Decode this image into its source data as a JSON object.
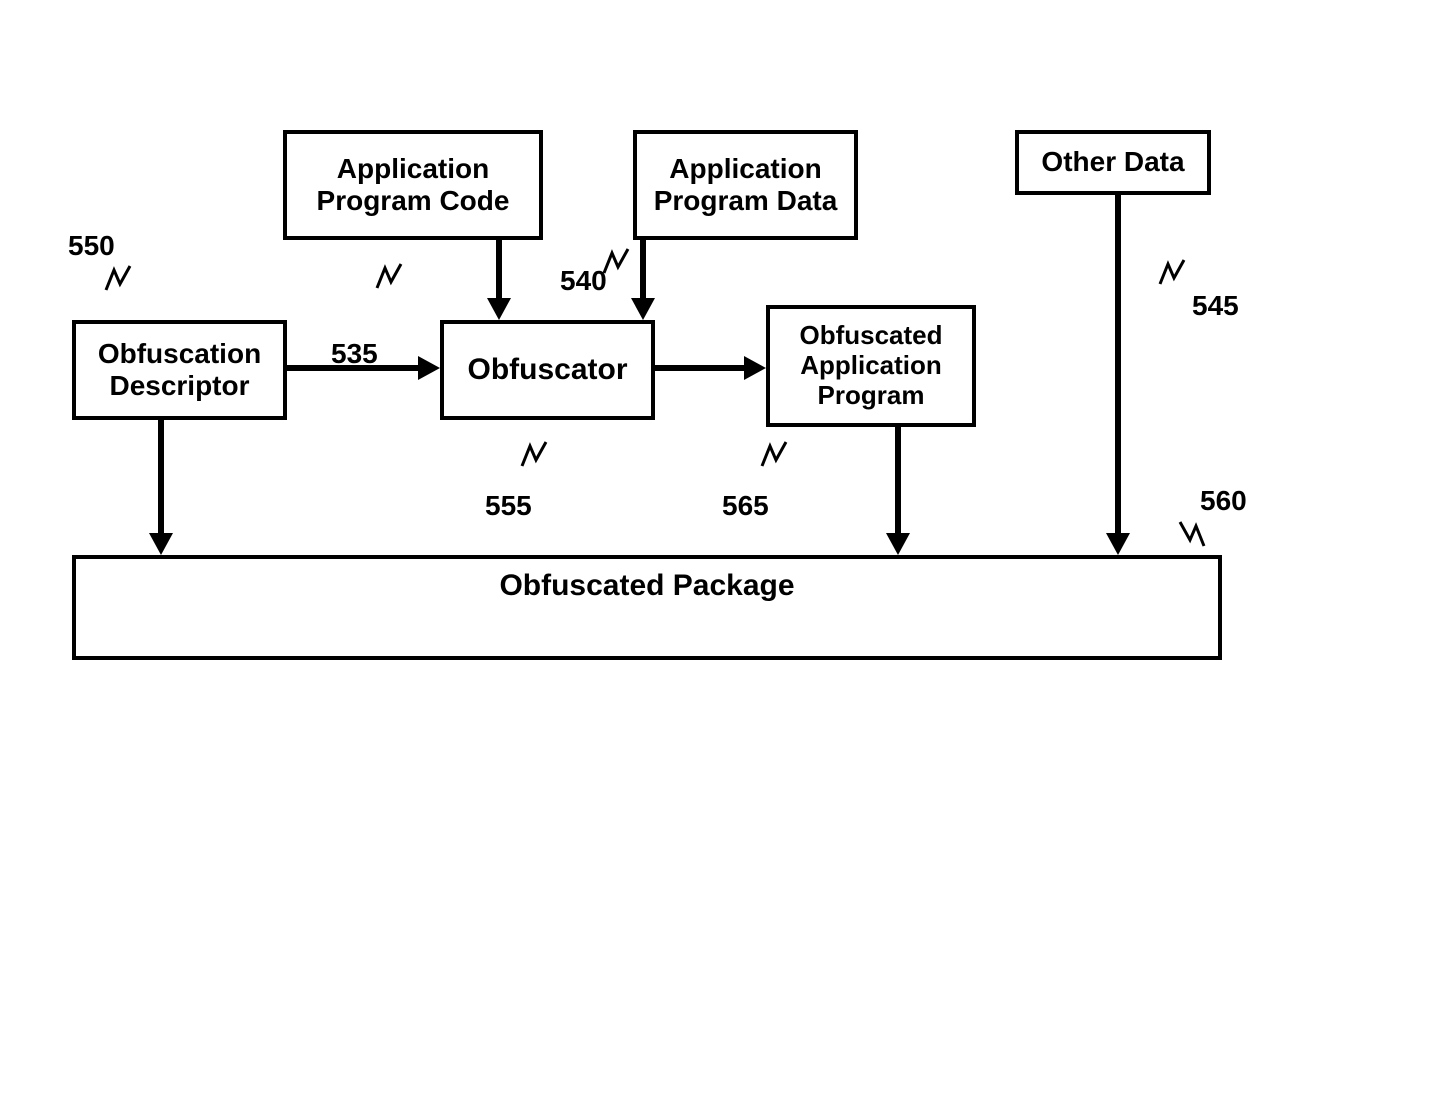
{
  "boxes": {
    "app_code": "Application\nProgram Code",
    "app_data": "Application\nProgram Data",
    "other_data": "Other Data",
    "obf_desc": "Obfuscation\nDescriptor",
    "obfuscator": "Obfuscator",
    "obf_app": "Obfuscated\nApplication\nProgram",
    "package": "Obfuscated Package"
  },
  "refs": {
    "r550": "550",
    "r535": "535",
    "r540": "540",
    "r545": "545",
    "r555": "555",
    "r565": "565",
    "r560": "560"
  }
}
